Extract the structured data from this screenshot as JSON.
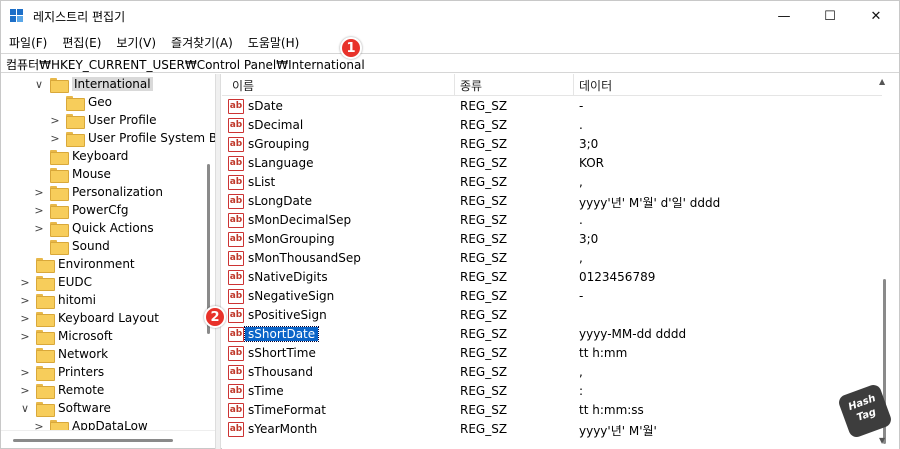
{
  "window": {
    "title": "레지스트리 편집기",
    "minimize_glyph": "—",
    "maximize_glyph": "☐",
    "close_glyph": "✕"
  },
  "menu": [
    "파일(F)",
    "편집(E)",
    "보기(V)",
    "즐겨찾기(A)",
    "도움말(H)"
  ],
  "address": "컴퓨터₩HKEY_CURRENT_USER₩Control Panel₩International",
  "callouts": [
    "1",
    "2"
  ],
  "tree": [
    {
      "label": "International",
      "expander": "∨",
      "level": 2,
      "selected": true
    },
    {
      "label": "Geo",
      "expander": "",
      "level": 3
    },
    {
      "label": "User Profile",
      "expander": ">",
      "level": 3
    },
    {
      "label": "User Profile System Ba",
      "expander": ">",
      "level": 3
    },
    {
      "label": "Keyboard",
      "expander": "",
      "level": 2
    },
    {
      "label": "Mouse",
      "expander": "",
      "level": 2
    },
    {
      "label": "Personalization",
      "expander": ">",
      "level": 2
    },
    {
      "label": "PowerCfg",
      "expander": ">",
      "level": 2
    },
    {
      "label": "Quick Actions",
      "expander": ">",
      "level": 2
    },
    {
      "label": "Sound",
      "expander": "",
      "level": 2
    },
    {
      "label": "Environment",
      "expander": "",
      "level": 1
    },
    {
      "label": "EUDC",
      "expander": ">",
      "level": 1
    },
    {
      "label": "hitomi",
      "expander": ">",
      "level": 1
    },
    {
      "label": "Keyboard Layout",
      "expander": ">",
      "level": 1
    },
    {
      "label": "Microsoft",
      "expander": ">",
      "level": 1
    },
    {
      "label": "Network",
      "expander": "",
      "level": 1
    },
    {
      "label": "Printers",
      "expander": ">",
      "level": 1
    },
    {
      "label": "Remote",
      "expander": ">",
      "level": 1
    },
    {
      "label": "Software",
      "expander": "∨",
      "level": 1
    },
    {
      "label": "AppDataLow",
      "expander": ">",
      "level": 2
    }
  ],
  "list": {
    "columns": [
      "이름",
      "종류",
      "데이터"
    ],
    "icon_text": "ab",
    "rows": [
      {
        "name": "sDate",
        "type": "REG_SZ",
        "data": "-"
      },
      {
        "name": "sDecimal",
        "type": "REG_SZ",
        "data": "."
      },
      {
        "name": "sGrouping",
        "type": "REG_SZ",
        "data": "3;0"
      },
      {
        "name": "sLanguage",
        "type": "REG_SZ",
        "data": "KOR"
      },
      {
        "name": "sList",
        "type": "REG_SZ",
        "data": ","
      },
      {
        "name": "sLongDate",
        "type": "REG_SZ",
        "data": "yyyy'년' M'월' d'일' dddd"
      },
      {
        "name": "sMonDecimalSep",
        "type": "REG_SZ",
        "data": "."
      },
      {
        "name": "sMonGrouping",
        "type": "REG_SZ",
        "data": "3;0"
      },
      {
        "name": "sMonThousandSep",
        "type": "REG_SZ",
        "data": ","
      },
      {
        "name": "sNativeDigits",
        "type": "REG_SZ",
        "data": "0123456789"
      },
      {
        "name": "sNegativeSign",
        "type": "REG_SZ",
        "data": "-"
      },
      {
        "name": "sPositiveSign",
        "type": "REG_SZ",
        "data": ""
      },
      {
        "name": "sShortDate",
        "type": "REG_SZ",
        "data": "yyyy-MM-dd dddd",
        "selected": true
      },
      {
        "name": "sShortTime",
        "type": "REG_SZ",
        "data": "tt h:mm"
      },
      {
        "name": "sThousand",
        "type": "REG_SZ",
        "data": ","
      },
      {
        "name": "sTime",
        "type": "REG_SZ",
        "data": ":"
      },
      {
        "name": "sTimeFormat",
        "type": "REG_SZ",
        "data": "tt h:mm:ss"
      },
      {
        "name": "sYearMonth",
        "type": "REG_SZ",
        "data": "yyyy'년' M'월'"
      }
    ]
  },
  "watermark": "Hash Tag",
  "colors": {
    "selection": "#0a64c8",
    "callout": "#e8322a",
    "folder": "#f7cd5b"
  }
}
